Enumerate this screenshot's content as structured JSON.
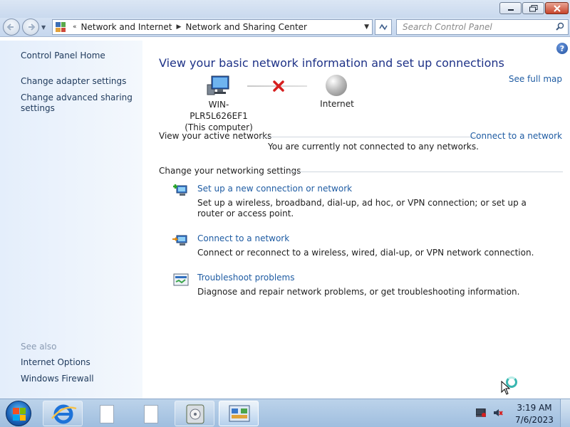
{
  "address": {
    "breadcrumbs": [
      "Network and Internet",
      "Network and Sharing Center"
    ],
    "search_placeholder": "Search Control Panel"
  },
  "sidebar": {
    "home": "Control Panel Home",
    "links": [
      "Change adapter settings",
      "Change advanced sharing settings"
    ],
    "see_also_label": "See also",
    "see_also": [
      "Internet Options",
      "Windows Firewall"
    ]
  },
  "main": {
    "title": "View your basic network information and set up connections",
    "see_full_map": "See full map",
    "computer_name": "WIN-PLR5L626EF1",
    "computer_sub": "(This computer)",
    "internet_label": "Internet",
    "active_networks_label": "View your active networks",
    "connect_link": "Connect to a network",
    "not_connected": "You are currently not connected to any networks.",
    "change_settings_label": "Change your networking settings",
    "tasks": [
      {
        "title": "Set up a new connection or network",
        "desc": "Set up a wireless, broadband, dial-up, ad hoc, or VPN connection; or set up a router or access point."
      },
      {
        "title": "Connect to a network",
        "desc": "Connect or reconnect to a wireless, wired, dial-up, or VPN network connection."
      },
      {
        "title": "Troubleshoot problems",
        "desc": "Diagnose and repair network problems, or get troubleshooting information."
      }
    ]
  },
  "taskbar": {
    "time": "3:19 AM",
    "date": "7/6/2023"
  },
  "colors": {
    "link": "#1f5ca3",
    "title": "#1e3287",
    "error_x": "#d61f1f"
  }
}
